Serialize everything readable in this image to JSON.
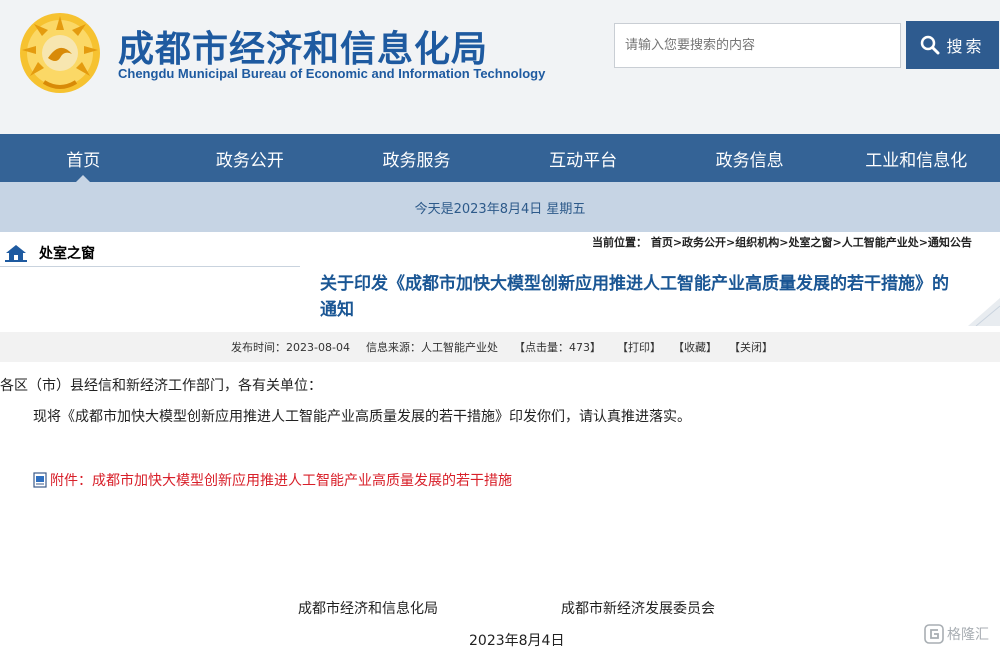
{
  "header": {
    "title_cn": "成都市经济和信息化局",
    "title_en": "Chengdu Municipal Bureau of Economic and Information Technology",
    "search_placeholder": "请输入您要搜索的内容",
    "search_button": "搜索"
  },
  "nav": {
    "items": [
      {
        "label": "首页",
        "active": true
      },
      {
        "label": "政务公开",
        "active": false
      },
      {
        "label": "政务服务",
        "active": false
      },
      {
        "label": "互动平台",
        "active": false
      },
      {
        "label": "政务信息",
        "active": false
      },
      {
        "label": "工业和信息化",
        "active": false
      }
    ]
  },
  "date_bar": "今天是2023年8月4日 星期五",
  "sidebar": {
    "section_title": "处室之窗"
  },
  "breadcrumb": "当前位置： 首页>政务公开>组织机构>处室之窗>人工智能产业处>通知公告",
  "article": {
    "title": "关于印发《成都市加快大模型创新应用推进人工智能产业高质量发展的若干措施》的通知",
    "meta": {
      "publish_time": "发布时间：2023-08-04",
      "source": "信息来源：人工智能产业处",
      "clicks": "【点击量：473】",
      "print": "【打印】",
      "favorite": "【收藏】",
      "close": "【关闭】"
    },
    "salutation": "各区（市）县经信和新经济工作部门，各有关单位：",
    "paragraph": "现将《成都市加快大模型创新应用推进人工智能产业高质量发展的若干措施》印发你们，请认真推进落实。",
    "attachment": "附件：成都市加快大模型创新应用推进人工智能产业高质量发展的若干措施",
    "signer_1": "成都市经济和信息化局",
    "signer_2": "成都市新经济发展委员会",
    "sign_date": "2023年8月4日"
  },
  "watermark": "格隆汇",
  "colors": {
    "brand_blue": "#1e5aa0",
    "nav_bg": "#346396",
    "date_bar_bg": "#c6d4e4",
    "attachment_red": "#d8202a",
    "logo_gold": "#f2b318"
  }
}
